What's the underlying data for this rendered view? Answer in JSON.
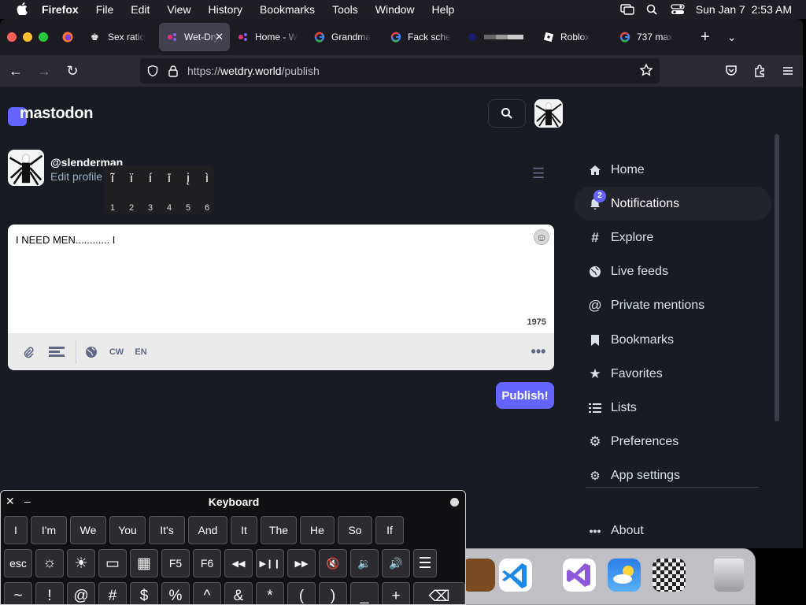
{
  "menubar": {
    "app": "Firefox",
    "menus": [
      "File",
      "Edit",
      "View",
      "History",
      "Bookmarks",
      "Tools",
      "Window",
      "Help"
    ],
    "datetime": "Sun Jan 7  2:53 AM"
  },
  "tabs": [
    {
      "label": "",
      "icon": "firefox-icon"
    },
    {
      "label": "Sex ratio",
      "icon": "crown-icon"
    },
    {
      "label": "Wet-Dry",
      "icon": "mastodon-icon",
      "active": true
    },
    {
      "label": "Home - W",
      "icon": "mastodon-icon"
    },
    {
      "label": "Grandma",
      "icon": "google-icon"
    },
    {
      "label": "Fack sche",
      "icon": "google-icon"
    },
    {
      "label": "",
      "icon": "circle-icon"
    },
    {
      "label": "Roblox",
      "icon": "roblox-icon"
    },
    {
      "label": "737 max",
      "icon": "google-icon"
    }
  ],
  "url": {
    "scheme": "https://",
    "host": "wetdry.world",
    "path": "/publish"
  },
  "logo": "mastodon",
  "profile": {
    "handle": "@slenderman",
    "edit": "Edit profile"
  },
  "accent_popup": {
    "chars": [
      "ĩ",
      "ï",
      "í",
      "ī",
      "į",
      "ì"
    ],
    "nums": [
      "1",
      "2",
      "3",
      "4",
      "5",
      "6"
    ]
  },
  "compose": {
    "text": "I NEED MEN............ I",
    "char_count": "1975",
    "cw": "CW",
    "lang": "EN"
  },
  "publish": "Publish!",
  "nav": {
    "items": [
      {
        "label": "Home",
        "icon": "home-icon"
      },
      {
        "label": "Notifications",
        "icon": "bell-icon",
        "badge": "2",
        "active": true
      },
      {
        "label": "Explore",
        "icon": "hash-icon"
      },
      {
        "label": "Live feeds",
        "icon": "globe-icon"
      },
      {
        "label": "Private mentions",
        "icon": "at-icon"
      },
      {
        "label": "Bookmarks",
        "icon": "bookmark-icon"
      },
      {
        "label": "Favorites",
        "icon": "star-icon"
      },
      {
        "label": "Lists",
        "icon": "list-icon"
      },
      {
        "label": "Preferences",
        "icon": "gear-icon"
      },
      {
        "label": "App settings",
        "icon": "gears-icon"
      }
    ],
    "about": "About"
  },
  "keyboard": {
    "title": "Keyboard",
    "suggestions": [
      "I",
      "I'm",
      "We",
      "You",
      "It's",
      "And",
      "It",
      "The",
      "He",
      "So",
      "If"
    ],
    "fn_row": [
      "esc",
      "☼",
      "☀",
      "▭",
      "▦",
      "F5",
      "F6",
      "◀◀",
      "▶❙❙",
      "▶▶",
      "🔇",
      "🔉",
      "🔊",
      "☰"
    ],
    "sym_row": [
      "~",
      "!",
      "@",
      "#",
      "$",
      "%",
      "^",
      "&",
      "*",
      "(",
      ")",
      "_",
      "+",
      "⌫"
    ]
  },
  "colors": {
    "accent": "#6364ff",
    "bg": "#191b22",
    "text": "#d9e1e8"
  }
}
